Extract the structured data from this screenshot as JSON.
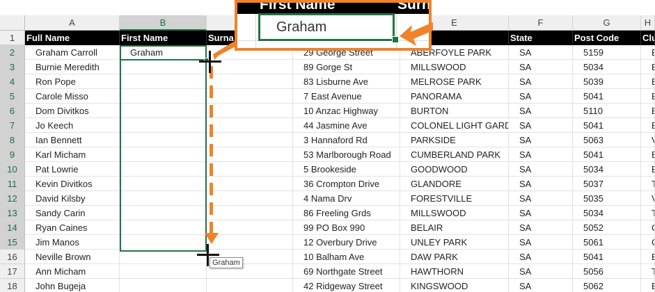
{
  "columns": [
    {
      "letter": "A",
      "header": "Full Name"
    },
    {
      "letter": "B",
      "header": "First Name"
    },
    {
      "letter": "C",
      "header": "Surna"
    },
    {
      "letter": "D",
      "header": ""
    },
    {
      "letter": "E",
      "header": ""
    },
    {
      "letter": "F",
      "header": "State"
    },
    {
      "letter": "G",
      "header": "Post Code"
    },
    {
      "letter": "H",
      "header": "Clu"
    }
  ],
  "row_numbers": [
    "1",
    "2",
    "3",
    "4",
    "5",
    "6",
    "7",
    "8",
    "9",
    "10",
    "11",
    "12",
    "13",
    "14",
    "15",
    "16",
    "17",
    "18"
  ],
  "rows": [
    {
      "full_name": "Graham Carroll",
      "first_name": "Graham",
      "address": "29 George Street",
      "suburb": "ABERFOYLE PARK",
      "state": "SA",
      "post_code": "5159",
      "club": "E"
    },
    {
      "full_name": "Burnie Meredith",
      "first_name": "",
      "address": "89 Gorge St",
      "suburb": "MILLSWOOD",
      "state": "SA",
      "post_code": "5034",
      "club": "E"
    },
    {
      "full_name": "Ron Pope",
      "first_name": "",
      "address": "83 Lisburne Ave",
      "suburb": "MELROSE PARK",
      "state": "SA",
      "post_code": "5039",
      "club": "E"
    },
    {
      "full_name": "Carole Misso",
      "first_name": "",
      "address": "7 East Avenue",
      "suburb": "PANORAMA",
      "state": "SA",
      "post_code": "5041",
      "club": "E"
    },
    {
      "full_name": "Dom Divitkos",
      "first_name": "",
      "address": "10 Anzac Highway",
      "suburb": "BURTON",
      "state": "SA",
      "post_code": "5110",
      "club": "E"
    },
    {
      "full_name": "Jo Keech",
      "first_name": "",
      "address": "44 Jasmine Ave",
      "suburb": "COLONEL LIGHT GARD",
      "state": "SA",
      "post_code": "5041",
      "club": "E"
    },
    {
      "full_name": "Ian Bennett",
      "first_name": "",
      "address": "3 Hannaford Rd",
      "suburb": "PARKSIDE",
      "state": "SA",
      "post_code": "5063",
      "club": "V"
    },
    {
      "full_name": "Karl Micham",
      "first_name": "",
      "address": "53 Marlborough Road",
      "suburb": "CUMBERLAND PARK",
      "state": "SA",
      "post_code": "5041",
      "club": "E"
    },
    {
      "full_name": "Pat Lowrie",
      "first_name": "",
      "address": "5 Brookeside",
      "suburb": "GOODWOOD",
      "state": "SA",
      "post_code": "5034",
      "club": "E"
    },
    {
      "full_name": "Kevin Divitkos",
      "first_name": "",
      "address": "36 Crompton Drive",
      "suburb": "GLANDORE",
      "state": "SA",
      "post_code": "5037",
      "club": "T"
    },
    {
      "full_name": "David Kilsby",
      "first_name": "",
      "address": "4 Nama Drv",
      "suburb": "FORESTVILLE",
      "state": "SA",
      "post_code": "5035",
      "club": "V"
    },
    {
      "full_name": "Sandy Carin",
      "first_name": "",
      "address": "86 Freeling Grds",
      "suburb": "MILLSWOOD",
      "state": "SA",
      "post_code": "5034",
      "club": "T"
    },
    {
      "full_name": "Ryan Caines",
      "first_name": "",
      "address": "99 PO Box 990",
      "suburb": "BELAIR",
      "state": "SA",
      "post_code": "5052",
      "club": "C"
    },
    {
      "full_name": "Jim Manos",
      "first_name": "",
      "address": "12 Overbury Drive",
      "suburb": "UNLEY PARK",
      "state": "SA",
      "post_code": "5061",
      "club": "C"
    },
    {
      "full_name": "Neville Brown",
      "first_name": "",
      "address": "10 Balham Ave",
      "suburb": "DAW PARK",
      "state": "SA",
      "post_code": "5041",
      "club": "E"
    },
    {
      "full_name": "Ann Micham",
      "first_name": "",
      "address": "69 Northgate Street",
      "suburb": "HAWTHORN",
      "state": "SA",
      "post_code": "5056",
      "club": "T"
    },
    {
      "full_name": "John Bugeja",
      "first_name": "",
      "address": "42 Ridgeway Street",
      "suburb": "KINGSWOOD",
      "state": "SA",
      "post_code": "5062",
      "club": "E"
    }
  ],
  "callout": {
    "header_left": "First Name",
    "header_right": "Surn",
    "cell_value": "Graham"
  },
  "tooltip": "Graham",
  "colors": {
    "accent": "#f0822a",
    "selection": "#217346"
  }
}
